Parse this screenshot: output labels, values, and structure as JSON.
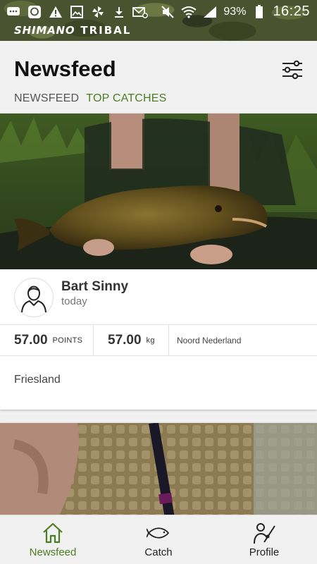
{
  "status_bar": {
    "battery_percent": "93%",
    "time": "16:25",
    "left_icons": [
      "chat-icon",
      "messenger-icon",
      "warning-icon",
      "gallery-icon",
      "pinwheel-icon",
      "download-icon",
      "email-icon"
    ],
    "right_icons": [
      "mute-icon",
      "wifi-icon",
      "signal-icon",
      "battery-icon"
    ]
  },
  "brand": {
    "name": "SHIMANO",
    "sub": "TRIBAL"
  },
  "header": {
    "title": "Newsfeed",
    "filter_icon": "sliders-icon",
    "tabs": [
      {
        "label": "NEWSFEED",
        "active": false
      },
      {
        "label": "TOP CATCHES",
        "active": true
      }
    ]
  },
  "feed": [
    {
      "author": "Bart Sinny",
      "time": "today",
      "points_value": "57.00",
      "points_label": "POINTS",
      "weight_value": "57.00",
      "weight_unit": "kg",
      "region": "Noord Nederland",
      "location": "Friesland"
    }
  ],
  "bottom_nav": [
    {
      "label": "Newsfeed",
      "icon": "home-icon",
      "active": true
    },
    {
      "label": "Catch",
      "icon": "fish-icon",
      "active": false
    },
    {
      "label": "Profile",
      "icon": "angler-icon",
      "active": false
    }
  ],
  "colors": {
    "accent": "#4c7d22",
    "camo": "#4a5330",
    "background": "#f1f1f1"
  }
}
